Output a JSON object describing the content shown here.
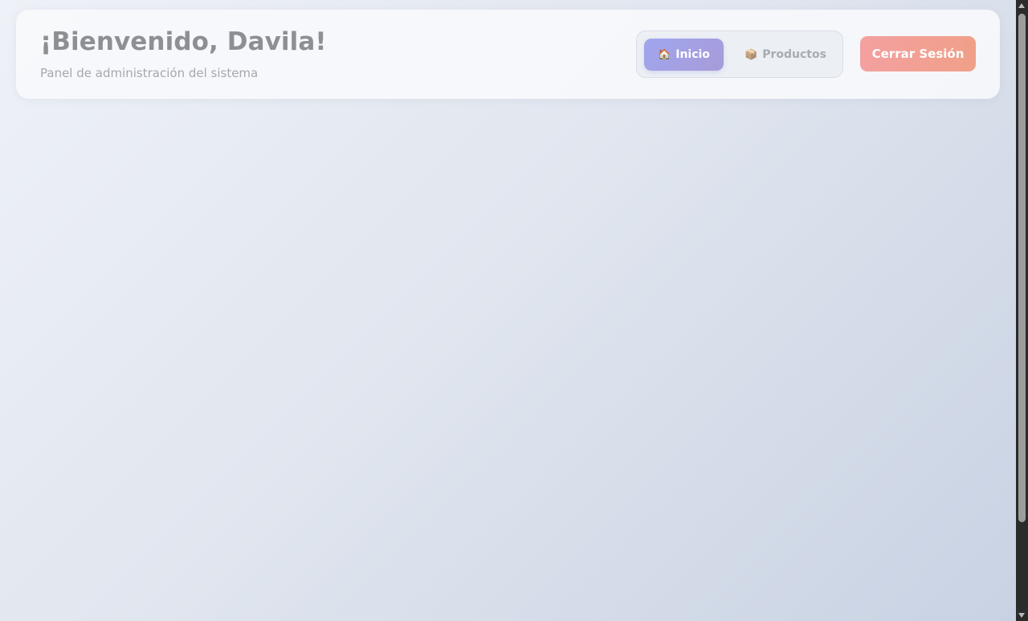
{
  "header": {
    "welcome": "¡Bienvenido, Davila!",
    "subtitle": "Panel de administración del sistema"
  },
  "nav": {
    "items": [
      {
        "icon": "🏠",
        "icon_name": "home-icon",
        "label": "Inicio",
        "active": true
      },
      {
        "icon": "📦",
        "icon_name": "package-icon",
        "label": "Productos",
        "active": false
      }
    ]
  },
  "logout": {
    "label": "Cerrar Sesión"
  },
  "colors": {
    "accent": "#a0a6ef",
    "logout": "#f3a0a0"
  }
}
